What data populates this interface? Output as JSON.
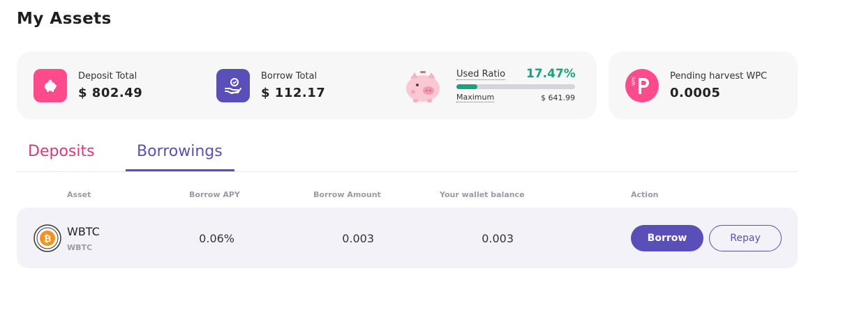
{
  "page": {
    "title": "My Assets"
  },
  "summary": {
    "deposit": {
      "label": "Deposit Total",
      "value": "$ 802.49",
      "icon": "piggy-bank-icon",
      "color": "#ff4b8b"
    },
    "borrow": {
      "label": "Borrow Total",
      "value": "$ 112.17",
      "icon": "hand-coin-icon",
      "color": "#5a4fb8"
    },
    "ratio": {
      "label": "Used Ratio",
      "value": "17.47%",
      "fraction": 0.1747,
      "max_label": "Maximum",
      "max_value": "$ 641.99",
      "color": "#1aa37a",
      "icon": "pig-illustration-icon"
    }
  },
  "harvest": {
    "label": "Pending harvest WPC",
    "value": "0.0005",
    "icon": "wpc-token-icon",
    "color": "#ff4b8b"
  },
  "tabs": [
    {
      "label": "Deposits",
      "active": false
    },
    {
      "label": "Borrowings",
      "active": true
    }
  ],
  "table": {
    "headers": [
      "Asset",
      "Borrow APY",
      "Borrow Amount",
      "Your wallet balance",
      "Action"
    ],
    "rows": [
      {
        "asset": "WBTC",
        "asset_sub": "WBTC",
        "icon": "bitcoin-icon",
        "borrow_apy": "0.06%",
        "borrow_amount": "0.003",
        "wallet_balance": "0.003",
        "actions": [
          "Borrow",
          "Repay"
        ]
      }
    ]
  }
}
